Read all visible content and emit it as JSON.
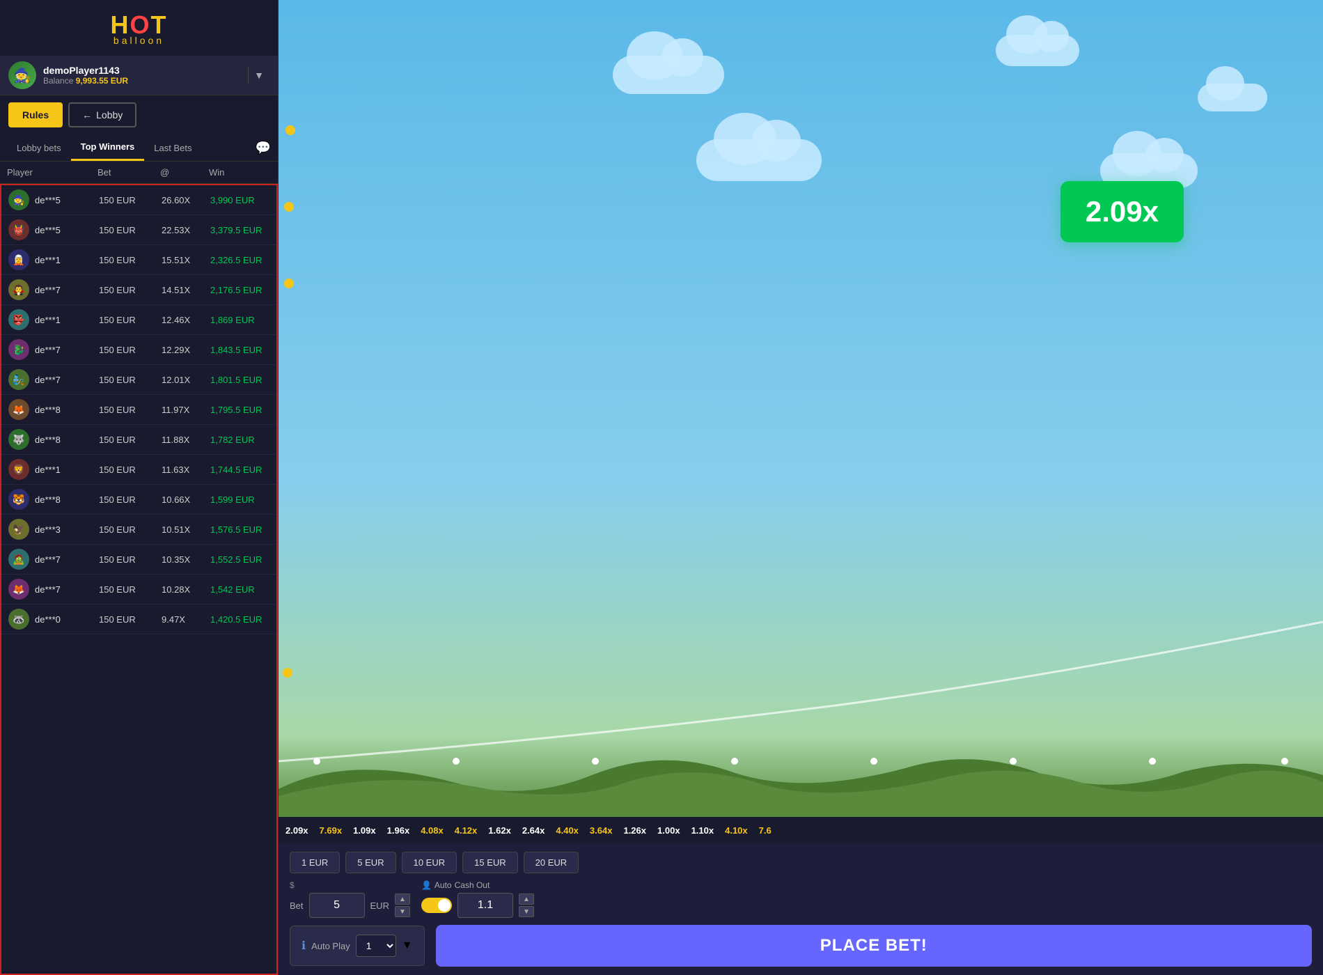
{
  "logo": {
    "hot": "HOT",
    "balloon": "balloon"
  },
  "user": {
    "name": "demoPlayer1143",
    "balance_label": "Balance",
    "balance": "9,993.55 EUR",
    "avatar_emoji": "🧙"
  },
  "buttons": {
    "rules": "Rules",
    "lobby": "Lobby",
    "place_bet": "PLACE BET!"
  },
  "tabs": {
    "lobby_bets": "Lobby bets",
    "top_winners": "Top Winners",
    "last_bets": "Last Bets"
  },
  "table": {
    "headers": [
      "Player",
      "Bet",
      "@",
      "Win"
    ],
    "rows": [
      {
        "player": "de***5",
        "bet": "150 EUR",
        "multiplier": "26.60X",
        "win": "3,990 EUR",
        "avatar": "👤"
      },
      {
        "player": "de***5",
        "bet": "150 EUR",
        "multiplier": "22.53X",
        "win": "3,379.5 EUR",
        "avatar": "👤"
      },
      {
        "player": "de***1",
        "bet": "150 EUR",
        "multiplier": "15.51X",
        "win": "2,326.5 EUR",
        "avatar": "👤"
      },
      {
        "player": "de***7",
        "bet": "150 EUR",
        "multiplier": "14.51X",
        "win": "2,176.5 EUR",
        "avatar": "👤"
      },
      {
        "player": "de***1",
        "bet": "150 EUR",
        "multiplier": "12.46X",
        "win": "1,869 EUR",
        "avatar": "👤"
      },
      {
        "player": "de***7",
        "bet": "150 EUR",
        "multiplier": "12.29X",
        "win": "1,843.5 EUR",
        "avatar": "👤"
      },
      {
        "player": "de***7",
        "bet": "150 EUR",
        "multiplier": "12.01X",
        "win": "1,801.5 EUR",
        "avatar": "👤"
      },
      {
        "player": "de***8",
        "bet": "150 EUR",
        "multiplier": "11.97X",
        "win": "1,795.5 EUR",
        "avatar": "👤"
      },
      {
        "player": "de***8",
        "bet": "150 EUR",
        "multiplier": "11.88X",
        "win": "1,782 EUR",
        "avatar": "👤"
      },
      {
        "player": "de***1",
        "bet": "150 EUR",
        "multiplier": "11.63X",
        "win": "1,744.5 EUR",
        "avatar": "👤"
      },
      {
        "player": "de***8",
        "bet": "150 EUR",
        "multiplier": "10.66X",
        "win": "1,599 EUR",
        "avatar": "👤"
      },
      {
        "player": "de***3",
        "bet": "150 EUR",
        "multiplier": "10.51X",
        "win": "1,576.5 EUR",
        "avatar": "👤"
      },
      {
        "player": "de***7",
        "bet": "150 EUR",
        "multiplier": "10.35X",
        "win": "1,552.5 EUR",
        "avatar": "👤"
      },
      {
        "player": "de***7",
        "bet": "150 EUR",
        "multiplier": "10.28X",
        "win": "1,542 EUR",
        "avatar": "👤"
      },
      {
        "player": "de***0",
        "bet": "150 EUR",
        "multiplier": "9.47X",
        "win": "1,420.5 EUR",
        "avatar": "👤"
      }
    ]
  },
  "multiplier_display": "2.09x",
  "multipliers_bar": [
    {
      "value": "2.09x",
      "color": "white"
    },
    {
      "value": "7.69x",
      "color": "yellow"
    },
    {
      "value": "1.09x",
      "color": "white"
    },
    {
      "value": "1.96x",
      "color": "white"
    },
    {
      "value": "4.08x",
      "color": "yellow"
    },
    {
      "value": "4.12x",
      "color": "yellow"
    },
    {
      "value": "1.62x",
      "color": "white"
    },
    {
      "value": "2.64x",
      "color": "white"
    },
    {
      "value": "4.40x",
      "color": "yellow"
    },
    {
      "value": "3.64x",
      "color": "yellow"
    },
    {
      "value": "1.26x",
      "color": "white"
    },
    {
      "value": "1.00x",
      "color": "white"
    },
    {
      "value": "1.10x",
      "color": "white"
    },
    {
      "value": "4.10x",
      "color": "yellow"
    },
    {
      "value": "7.6",
      "color": "yellow"
    }
  ],
  "quick_bets": [
    "1 EUR",
    "5 EUR",
    "10 EUR",
    "15 EUR",
    "20 EUR"
  ],
  "bet": {
    "dollar_sign": "$",
    "label": "Bet",
    "value": "5",
    "currency": "EUR"
  },
  "auto_cashout": {
    "label": "Auto",
    "label2": "Cash Out",
    "value": "1.1",
    "enabled": true
  },
  "autoplay": {
    "info_label": "Auto Play",
    "value": "1"
  }
}
